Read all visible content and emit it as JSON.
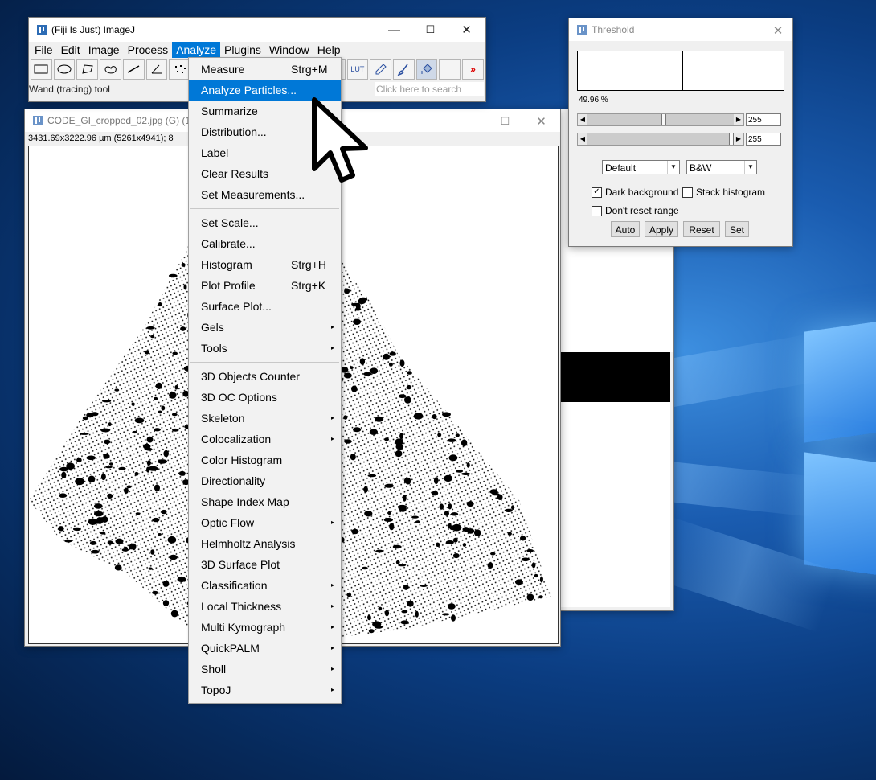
{
  "main_window": {
    "title": "(Fiji Is Just) ImageJ",
    "minimize": "—",
    "maximize": "☐",
    "close": "✕",
    "menus": [
      "File",
      "Edit",
      "Image",
      "Process",
      "Analyze",
      "Plugins",
      "Window",
      "Help"
    ],
    "active_menu": "Analyze",
    "tools": [
      "rectangle-tool",
      "oval-tool",
      "polygon-tool",
      "freehand-tool",
      "line-tool",
      "angle-tool",
      "multipoint-tool"
    ],
    "right_tools": {
      "partial": "k",
      "lut": "LUT",
      "more": "»"
    },
    "status": "Wand (tracing) tool",
    "search_placeholder": "Click here to search"
  },
  "image_window": {
    "title": "CODE_GI_cropped_02.jpg (G) (12.",
    "info": "3431.69x3222.96 µm (5261x4941); 8",
    "maximize": "☐",
    "close": "✕"
  },
  "threshold": {
    "title": "Threshold",
    "close": "✕",
    "percent": "49.96 %",
    "slider1_value": "255",
    "slider2_value": "255",
    "method": "Default",
    "mode": "B&W",
    "dark_background_label": "Dark background",
    "dark_background_checked": true,
    "stack_histogram_label": "Stack histogram",
    "dont_reset_label": "Don't reset range",
    "auto": "Auto",
    "apply": "Apply",
    "reset": "Reset",
    "set": "Set"
  },
  "analyze_menu": {
    "items": [
      {
        "label": "Measure",
        "shortcut": "Strg+M"
      },
      {
        "label": "Analyze Particles...",
        "highlighted": true
      },
      {
        "label": "Summarize"
      },
      {
        "label": "Distribution..."
      },
      {
        "label": "Label"
      },
      {
        "label": "Clear Results"
      },
      {
        "label": "Set Measurements..."
      },
      {
        "label": "Set Scale..."
      },
      {
        "label": "Calibrate..."
      },
      {
        "label": "Histogram",
        "shortcut": "Strg+H"
      },
      {
        "label": "Plot Profile",
        "shortcut": "Strg+K"
      },
      {
        "label": "Surface Plot..."
      },
      {
        "label": "Gels",
        "submenu": true
      },
      {
        "label": "Tools",
        "submenu": true
      },
      {
        "label": "3D Objects Counter"
      },
      {
        "label": "3D OC Options"
      },
      {
        "label": "Skeleton",
        "submenu": true
      },
      {
        "label": "Colocalization",
        "submenu": true
      },
      {
        "label": "Color Histogram"
      },
      {
        "label": "Directionality"
      },
      {
        "label": "Shape Index Map"
      },
      {
        "label": "Optic Flow",
        "submenu": true
      },
      {
        "label": "Helmholtz Analysis"
      },
      {
        "label": "3D Surface Plot"
      },
      {
        "label": "Classification",
        "submenu": true
      },
      {
        "label": "Local Thickness",
        "submenu": true
      },
      {
        "label": "Multi Kymograph",
        "submenu": true
      },
      {
        "label": "QuickPALM",
        "submenu": true
      },
      {
        "label": "Sholl",
        "submenu": true
      },
      {
        "label": "TopoJ",
        "submenu": true
      }
    ],
    "submenu_glyph": "▸"
  },
  "colors": {
    "highlight": "#0078d7",
    "desktop": "#0b3d82"
  }
}
